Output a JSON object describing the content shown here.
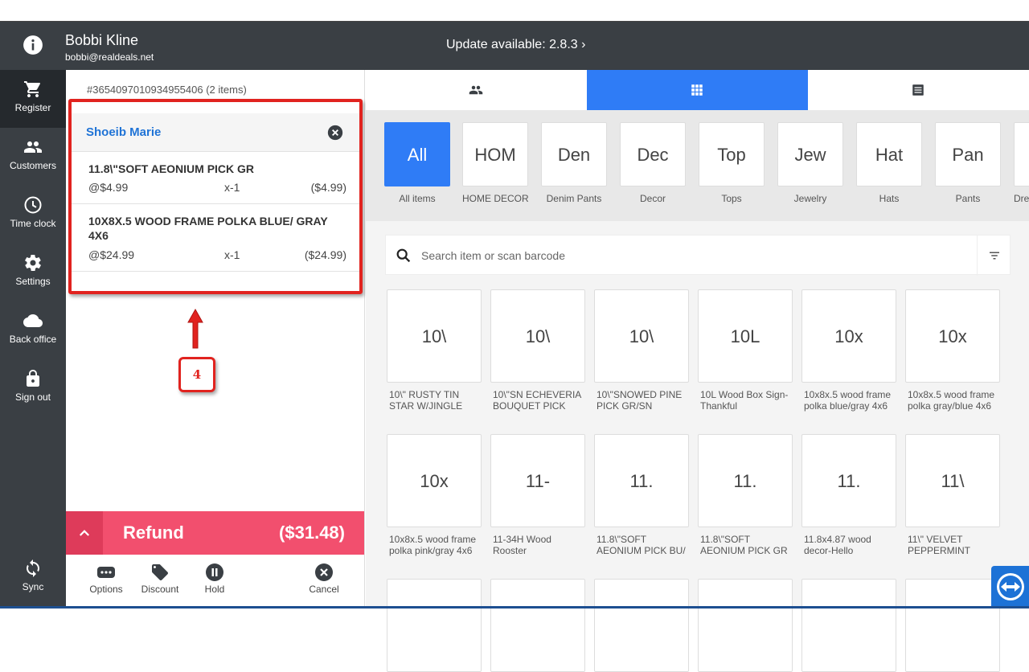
{
  "header": {
    "user_name": "Bobbi Kline",
    "user_email": "bobbi@realdeals.net",
    "update_text": "Update available: 2.8.3 ›"
  },
  "sidebar": {
    "items": [
      {
        "label": "Register",
        "icon": "cart-icon"
      },
      {
        "label": "Customers",
        "icon": "people-icon"
      },
      {
        "label": "Time clock",
        "icon": "clock-icon"
      },
      {
        "label": "Settings",
        "icon": "gear-icon"
      },
      {
        "label": "Back office",
        "icon": "cloud-icon"
      },
      {
        "label": "Sign out",
        "icon": "lock-icon"
      }
    ],
    "sync_label": "Sync"
  },
  "cart": {
    "receipt_id": "#3654097010934955406 (2 items)",
    "customer_name": "Shoeib Marie",
    "lines": [
      {
        "title": "11.8\\\"SOFT AEONIUM PICK GR",
        "price": "@$4.99",
        "qty": "x-1",
        "total": "($4.99)"
      },
      {
        "title": "10X8X.5 WOOD FRAME POLKA BLUE/ GRAY 4X6",
        "price": "@$24.99",
        "qty": "x-1",
        "total": "($24.99)"
      }
    ],
    "annotation_step": "4",
    "refund_label": "Refund",
    "refund_amount": "($31.48)",
    "actions": {
      "options": "Options",
      "discount": "Discount",
      "hold": "Hold",
      "cancel": "Cancel"
    }
  },
  "categories": [
    {
      "short": "All",
      "label": "All items"
    },
    {
      "short": "HOM",
      "label": "HOME DECOR"
    },
    {
      "short": "Den",
      "label": "Denim Pants"
    },
    {
      "short": "Dec",
      "label": "Decor"
    },
    {
      "short": "Top",
      "label": "Tops"
    },
    {
      "short": "Jew",
      "label": "Jewelry"
    },
    {
      "short": "Hat",
      "label": "Hats"
    },
    {
      "short": "Pan",
      "label": "Pants"
    },
    {
      "short": "",
      "label": "Dre"
    }
  ],
  "search": {
    "placeholder": "Search item or scan barcode"
  },
  "products": [
    {
      "short": "10\\",
      "name": "10\\\" RUSTY TIN STAR W/JINGLE"
    },
    {
      "short": "10\\",
      "name": "10\\\"SN ECHEVERIA BOUQUET PICK"
    },
    {
      "short": "10\\",
      "name": "10\\\"SNOWED PINE PICK GR/SN"
    },
    {
      "short": "10L",
      "name": "10L Wood Box Sign-Thankful"
    },
    {
      "short": "10x",
      "name": "10x8x.5 wood frame polka blue/gray 4x6"
    },
    {
      "short": "10x",
      "name": "10x8x.5 wood frame polka gray/blue 4x6"
    },
    {
      "short": "10x",
      "name": "10x8x.5 wood frame polka pink/gray 4x6"
    },
    {
      "short": "11-",
      "name": "11-34H Wood Rooster"
    },
    {
      "short": "11.",
      "name": "11.8\\\"SOFT AEONIUM PICK BU/"
    },
    {
      "short": "11.",
      "name": "11.8\\\"SOFT AEONIUM PICK GR"
    },
    {
      "short": "11.",
      "name": "11.8x4.87 wood decor-Hello"
    },
    {
      "short": "11\\",
      "name": "11\\\" VELVET PEPPERMINT"
    }
  ],
  "colors": {
    "accent": "#2f7cf6",
    "refund": "#f24f6e",
    "annotation": "#e1231f",
    "header_bg": "#3a3f44"
  }
}
